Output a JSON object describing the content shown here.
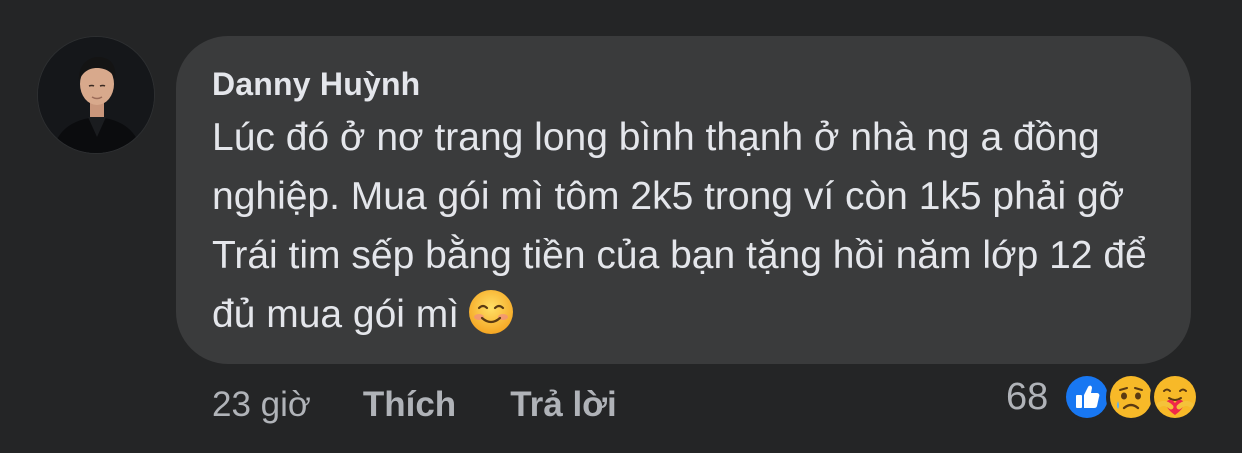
{
  "comment": {
    "author": "Danny Huỳnh",
    "text": "Lúc đó ở nơ trang long bình thạnh ở nhà ng a đồng nghiệp. Mua gói mì tôm 2k5 trong ví còn 1k5 phải gỡ Trái tim sếp bằng tiền của bạn tặng hồi năm lớp 12 để đủ mua gói mì",
    "emoji": "smiling-face-emoji"
  },
  "actions": {
    "time": "23 giờ",
    "like_label": "Thích",
    "reply_label": "Trả lời"
  },
  "reactions": {
    "count": "68",
    "types": [
      "like-reaction-icon",
      "sad-reaction-icon",
      "care-reaction-icon"
    ]
  },
  "colors": {
    "background": "#242526",
    "bubble": "#3a3b3c",
    "text": "#e4e6eb",
    "secondary_text": "#b0b3b8",
    "like_blue": "#1877f2",
    "reaction_yellow": "#f7b928"
  }
}
